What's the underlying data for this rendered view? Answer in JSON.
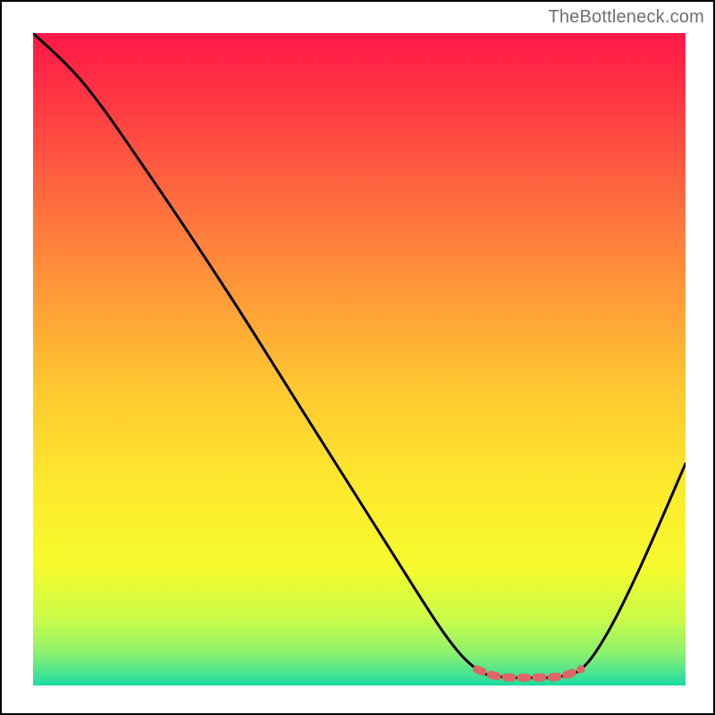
{
  "watermark": "TheBottleneck.com",
  "chart_data": {
    "type": "line",
    "title": "",
    "xlabel": "",
    "ylabel": "",
    "xlim": [
      0,
      100
    ],
    "ylim": [
      0,
      100
    ],
    "curve": [
      {
        "x": 0,
        "y": 100
      },
      {
        "x": 8,
        "y": 92
      },
      {
        "x": 18,
        "y": 78
      },
      {
        "x": 30,
        "y": 60
      },
      {
        "x": 42,
        "y": 41
      },
      {
        "x": 54,
        "y": 22
      },
      {
        "x": 63,
        "y": 8
      },
      {
        "x": 68,
        "y": 2.5
      },
      {
        "x": 72,
        "y": 1.3
      },
      {
        "x": 76,
        "y": 1.2
      },
      {
        "x": 80,
        "y": 1.3
      },
      {
        "x": 84,
        "y": 2.5
      },
      {
        "x": 88,
        "y": 8
      },
      {
        "x": 93,
        "y": 18
      },
      {
        "x": 100,
        "y": 34
      }
    ],
    "marker_segment": [
      {
        "x": 68,
        "y": 2.5
      },
      {
        "x": 70,
        "y": 1.7
      },
      {
        "x": 72,
        "y": 1.3
      },
      {
        "x": 74,
        "y": 1.2
      },
      {
        "x": 76,
        "y": 1.2
      },
      {
        "x": 78,
        "y": 1.25
      },
      {
        "x": 80,
        "y": 1.3
      },
      {
        "x": 82,
        "y": 1.7
      },
      {
        "x": 84,
        "y": 2.5
      }
    ],
    "gradient_stops": [
      {
        "offset": 0.0,
        "color": "#ff1846"
      },
      {
        "offset": 0.1,
        "color": "#ff3744"
      },
      {
        "offset": 0.25,
        "color": "#ff6a3f"
      },
      {
        "offset": 0.4,
        "color": "#ff9a38"
      },
      {
        "offset": 0.55,
        "color": "#ffc931"
      },
      {
        "offset": 0.7,
        "color": "#feea2d"
      },
      {
        "offset": 0.82,
        "color": "#f5fb2d"
      },
      {
        "offset": 0.9,
        "color": "#c8fb4a"
      },
      {
        "offset": 0.95,
        "color": "#8ef16e"
      },
      {
        "offset": 0.98,
        "color": "#4ce48f"
      },
      {
        "offset": 1.0,
        "color": "#1cdca3"
      }
    ],
    "marker_color": "#e06666",
    "curve_color": "#000000"
  }
}
